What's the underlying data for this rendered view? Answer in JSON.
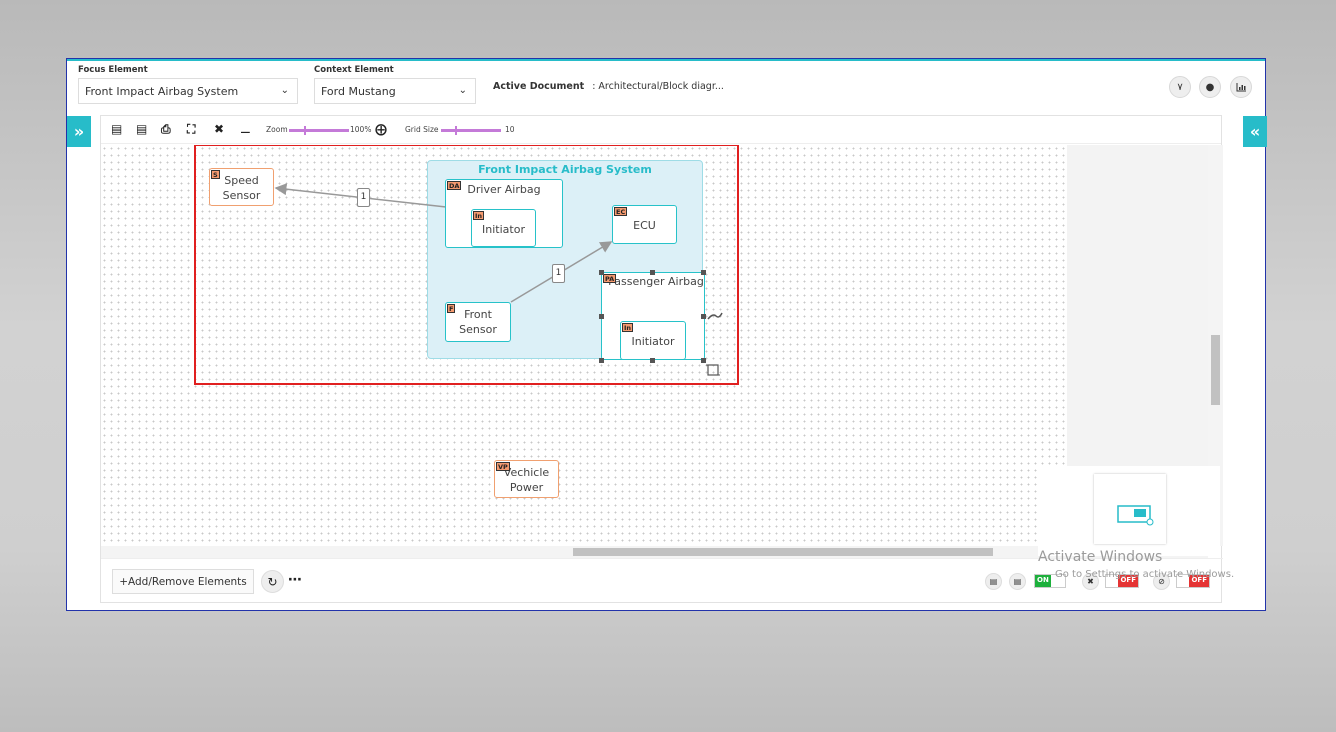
{
  "header": {
    "focus_label": "Focus Element",
    "focus_value": "Front Impact Airbag System",
    "context_label": "Context Element",
    "context_value": "Ford Mustang",
    "active_doc_label": "Active Document",
    "active_doc_value": ": Architectural/Block diagr...",
    "icons": [
      "vertical-diagram-icon",
      "drop-icon",
      "chart-icon"
    ]
  },
  "toolbar": {
    "zoom_label": "Zoom",
    "zoom_value": "100%",
    "grid_label": "Grid Size",
    "grid_value": "10"
  },
  "diagram": {
    "group_title": "Front Impact Airbag System",
    "nodes": {
      "speed_sensor": {
        "tag": "S",
        "line1": "Speed",
        "line2": "Sensor"
      },
      "driver_airbag": {
        "tag": "DA",
        "label": "Driver Airbag"
      },
      "driver_initiator": {
        "tag": "In",
        "label": "Initiator"
      },
      "ecu": {
        "tag": "EC",
        "label": "ECU"
      },
      "front_sensor": {
        "tag": "F",
        "line1": "Front",
        "line2": "Sensor"
      },
      "passenger_airbag": {
        "tag": "PA",
        "label": "Passenger Airbag"
      },
      "passenger_initiator": {
        "tag": "In",
        "label": "Initiator"
      },
      "vehicle_power": {
        "tag": "VP",
        "line1": "Vechicle",
        "line2": "Power"
      }
    },
    "connector_labels": [
      "1",
      "1"
    ]
  },
  "bottom": {
    "add_label": "+Add/Remove Elements",
    "toggle_on": "ON",
    "toggle_off_1": "OFF",
    "toggle_off_2": "OFF"
  },
  "watermark": {
    "line1": "Activate Windows",
    "line2": "Go to Settings to activate Windows."
  }
}
